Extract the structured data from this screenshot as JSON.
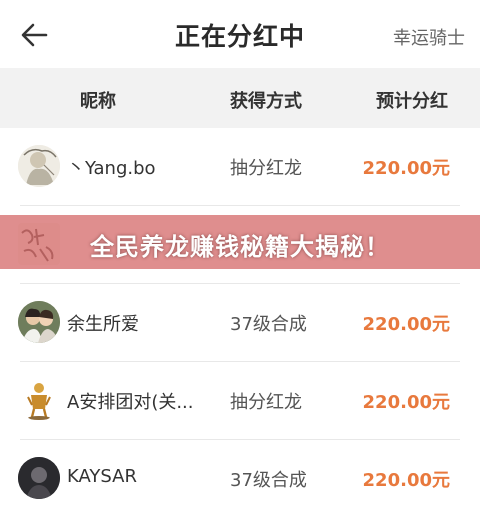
{
  "header": {
    "back_icon": "arrow-left-icon",
    "title": "正在分红中",
    "right_text": "幸运骑士"
  },
  "table": {
    "columns": [
      "昵称",
      "获得方式",
      "预计分红"
    ],
    "rows": [
      {
        "nickname": "丶Yang.bo",
        "method": "抽分红龙",
        "amount": "220.00元",
        "avatar": "avatar-sketch"
      },
      {
        "nickname": "",
        "method": "",
        "amount": "",
        "avatar": "avatar-calligraphy"
      },
      {
        "nickname": "余生所爱",
        "method": "37级合成",
        "amount": "220.00元",
        "avatar": "avatar-couple"
      },
      {
        "nickname": "A安排团对(关...",
        "method": "抽分红龙",
        "amount": "220.00元",
        "avatar": "avatar-golden-figure"
      },
      {
        "nickname": "KAYSAR",
        "method": "37级合成",
        "amount": "220.00元",
        "avatar": "avatar-dark"
      }
    ]
  },
  "banner": {
    "text": "全民养龙赚钱秘籍大揭秘！"
  },
  "colors": {
    "accent": "#e8793d",
    "banner": "#d66e6e",
    "header_bg": "#f2f2f2"
  }
}
